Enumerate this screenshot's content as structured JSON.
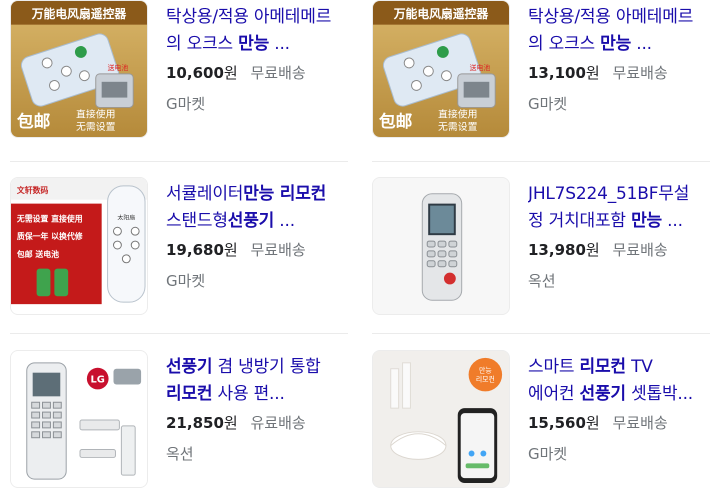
{
  "products": [
    {
      "title_parts": [
        [
          "탁상용/적용 아메테메르 의 오크스 ",
          false
        ],
        [
          "만능",
          true
        ],
        [
          " ...",
          false
        ]
      ],
      "price": "10,600",
      "unit": "원",
      "shipping": "무료배송",
      "seller": "G마켓",
      "image": "remote-control-gold-box",
      "image_text": [
        "万能电风扇遥控器",
        "包邮",
        "直接使用",
        "无需设置",
        "送电池"
      ]
    },
    {
      "title_parts": [
        [
          "탁상용/적용 아메테메르 의 오크스 ",
          false
        ],
        [
          "만능",
          true
        ],
        [
          " ...",
          false
        ]
      ],
      "price": "13,100",
      "unit": "원",
      "shipping": "무료배송",
      "seller": "G마켓",
      "image": "remote-control-gold-box",
      "image_text": [
        "万能电风扇遥控器",
        "包邮",
        "直接使用",
        "无需设置",
        "送电池"
      ]
    },
    {
      "title_parts": [
        [
          "서큘레이터",
          false
        ],
        [
          "만능 리모컨",
          true
        ],
        [
          " 스탠드형",
          false
        ],
        [
          "선풍기",
          true
        ],
        [
          " ...",
          false
        ]
      ],
      "price": "19,680",
      "unit": "원",
      "shipping": "무료배송",
      "seller": "G마켓",
      "image": "remote-control-red-banner",
      "image_text": [
        "文轩数码",
        "无需设置 直接使用",
        "质保一年 以换代修",
        "包邮 送电池",
        "太阳扇"
      ]
    },
    {
      "title_parts": [
        [
          "JHL7S224_51BF무설정 거치대포함 ",
          false
        ],
        [
          "만능",
          true
        ],
        [
          " ...",
          false
        ]
      ],
      "price": "13,980",
      "unit": "원",
      "shipping": "무료배송",
      "seller": "옥션",
      "image": "ac-remote-gray"
    },
    {
      "title_parts": [
        [
          "선풍기",
          true
        ],
        [
          " 겸 냉방기 통합 ",
          false
        ],
        [
          "리모컨",
          true
        ],
        [
          " 사용 편...",
          false
        ]
      ],
      "price": "21,850",
      "unit": "원",
      "shipping": "유료배송",
      "seller": "옥션",
      "image": "ac-remote-lg"
    },
    {
      "title_parts": [
        [
          "스마트 ",
          false
        ],
        [
          "리모컨",
          true
        ],
        [
          " TV 에어컨 ",
          false
        ],
        [
          "선풍기",
          true
        ],
        [
          " 셋톱박...",
          false
        ]
      ],
      "price": "15,560",
      "unit": "원",
      "shipping": "무료배송",
      "seller": "G마켓",
      "image": "smart-hub-phone",
      "image_text": [
        "만능",
        "리모컨"
      ]
    }
  ],
  "colors": {
    "title_link": "#1a0dab",
    "price": "#202124",
    "meta": "#70757a",
    "divider": "#ebebeb"
  }
}
